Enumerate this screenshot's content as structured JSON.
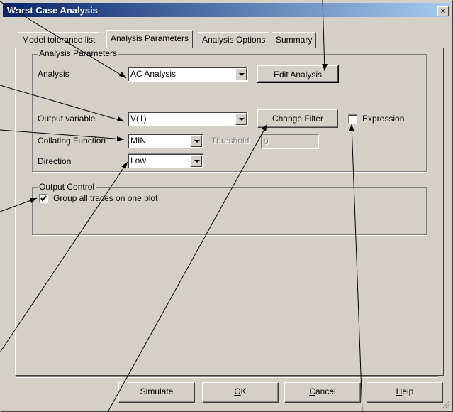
{
  "window": {
    "title": "Worst Case Analysis",
    "close_glyph": "×"
  },
  "tabs": [
    {
      "label": "Model tolerance list",
      "active": false
    },
    {
      "label": "Analysis Parameters",
      "active": true
    },
    {
      "label": "Analysis Options",
      "active": false
    },
    {
      "label": "Summary",
      "active": false
    }
  ],
  "analysis_parameters": {
    "group_label": "Analysis Parameters",
    "analysis": {
      "label": "Analysis",
      "value": "AC Analysis"
    },
    "edit_analysis_button": "Edit Analysis",
    "output_variable": {
      "label": "Output variable",
      "value": "V(1)"
    },
    "change_filter_button": "Change Filter",
    "expression_checkbox": {
      "label": "Expression",
      "checked": false
    },
    "collating_function": {
      "label": "Collating Function",
      "value": "MIN"
    },
    "threshold": {
      "label": "Threshold",
      "value": "0"
    },
    "direction": {
      "label": "Direction",
      "value": "Low"
    }
  },
  "output_control": {
    "group_label": "Output Control",
    "group_traces_checkbox": {
      "label": "Group all traces on one plot",
      "checked": true
    }
  },
  "footer_buttons": {
    "simulate": "Simulate",
    "ok_prefix": "",
    "ok_mnemonic": "O",
    "ok_rest": "K",
    "cancel_mnemonic": "C",
    "cancel_rest": "ancel",
    "help_mnemonic": "H",
    "help_rest": "elp"
  },
  "colors": {
    "dialog_bg": "#d4d0c8",
    "titlebar_start": "#0a246a",
    "titlebar_end": "#a6caf0",
    "disabled_text": "#808080"
  },
  "icons": {
    "check": "checkmark-icon",
    "dropdown": "chevron-down-icon",
    "close": "close-icon"
  }
}
